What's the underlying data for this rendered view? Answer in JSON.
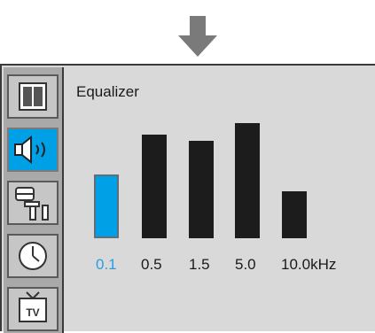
{
  "icons": {
    "arrow": "down-arrow-icon",
    "picture": "picture-icon",
    "sound": "speaker-icon",
    "setup": "tools-icon",
    "timer": "clock-icon",
    "tv": "tv-icon"
  },
  "sidebar": {
    "tv_label": "TV",
    "active_item": "sound"
  },
  "equalizer": {
    "title": "Equalizer",
    "selected_index": 0,
    "bands": [
      {
        "label": "0.1",
        "level": 0.45
      },
      {
        "label": "0.5",
        "level": 0.73
      },
      {
        "label": "1.5",
        "level": 0.69
      },
      {
        "label": "5.0",
        "level": 0.81
      },
      {
        "label": "10.0kHz",
        "level": 0.33
      }
    ]
  },
  "colors": {
    "accent": "#00a0e6",
    "bar": "#1c1c1c",
    "panel": "#d9d9d9",
    "sidebar": "#a9a9a9"
  }
}
